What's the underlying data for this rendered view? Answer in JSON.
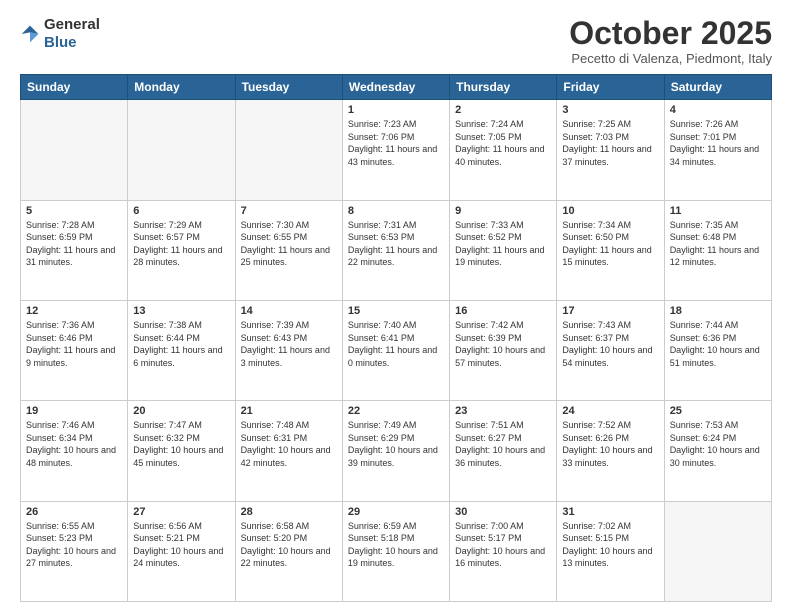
{
  "logo": {
    "general": "General",
    "blue": "Blue"
  },
  "title": "October 2025",
  "location": "Pecetto di Valenza, Piedmont, Italy",
  "days_of_week": [
    "Sunday",
    "Monday",
    "Tuesday",
    "Wednesday",
    "Thursday",
    "Friday",
    "Saturday"
  ],
  "weeks": [
    [
      {
        "day": "",
        "sunrise": "",
        "sunset": "",
        "daylight": ""
      },
      {
        "day": "",
        "sunrise": "",
        "sunset": "",
        "daylight": ""
      },
      {
        "day": "",
        "sunrise": "",
        "sunset": "",
        "daylight": ""
      },
      {
        "day": "1",
        "sunrise": "Sunrise: 7:23 AM",
        "sunset": "Sunset: 7:06 PM",
        "daylight": "Daylight: 11 hours and 43 minutes."
      },
      {
        "day": "2",
        "sunrise": "Sunrise: 7:24 AM",
        "sunset": "Sunset: 7:05 PM",
        "daylight": "Daylight: 11 hours and 40 minutes."
      },
      {
        "day": "3",
        "sunrise": "Sunrise: 7:25 AM",
        "sunset": "Sunset: 7:03 PM",
        "daylight": "Daylight: 11 hours and 37 minutes."
      },
      {
        "day": "4",
        "sunrise": "Sunrise: 7:26 AM",
        "sunset": "Sunset: 7:01 PM",
        "daylight": "Daylight: 11 hours and 34 minutes."
      }
    ],
    [
      {
        "day": "5",
        "sunrise": "Sunrise: 7:28 AM",
        "sunset": "Sunset: 6:59 PM",
        "daylight": "Daylight: 11 hours and 31 minutes."
      },
      {
        "day": "6",
        "sunrise": "Sunrise: 7:29 AM",
        "sunset": "Sunset: 6:57 PM",
        "daylight": "Daylight: 11 hours and 28 minutes."
      },
      {
        "day": "7",
        "sunrise": "Sunrise: 7:30 AM",
        "sunset": "Sunset: 6:55 PM",
        "daylight": "Daylight: 11 hours and 25 minutes."
      },
      {
        "day": "8",
        "sunrise": "Sunrise: 7:31 AM",
        "sunset": "Sunset: 6:53 PM",
        "daylight": "Daylight: 11 hours and 22 minutes."
      },
      {
        "day": "9",
        "sunrise": "Sunrise: 7:33 AM",
        "sunset": "Sunset: 6:52 PM",
        "daylight": "Daylight: 11 hours and 19 minutes."
      },
      {
        "day": "10",
        "sunrise": "Sunrise: 7:34 AM",
        "sunset": "Sunset: 6:50 PM",
        "daylight": "Daylight: 11 hours and 15 minutes."
      },
      {
        "day": "11",
        "sunrise": "Sunrise: 7:35 AM",
        "sunset": "Sunset: 6:48 PM",
        "daylight": "Daylight: 11 hours and 12 minutes."
      }
    ],
    [
      {
        "day": "12",
        "sunrise": "Sunrise: 7:36 AM",
        "sunset": "Sunset: 6:46 PM",
        "daylight": "Daylight: 11 hours and 9 minutes."
      },
      {
        "day": "13",
        "sunrise": "Sunrise: 7:38 AM",
        "sunset": "Sunset: 6:44 PM",
        "daylight": "Daylight: 11 hours and 6 minutes."
      },
      {
        "day": "14",
        "sunrise": "Sunrise: 7:39 AM",
        "sunset": "Sunset: 6:43 PM",
        "daylight": "Daylight: 11 hours and 3 minutes."
      },
      {
        "day": "15",
        "sunrise": "Sunrise: 7:40 AM",
        "sunset": "Sunset: 6:41 PM",
        "daylight": "Daylight: 11 hours and 0 minutes."
      },
      {
        "day": "16",
        "sunrise": "Sunrise: 7:42 AM",
        "sunset": "Sunset: 6:39 PM",
        "daylight": "Daylight: 10 hours and 57 minutes."
      },
      {
        "day": "17",
        "sunrise": "Sunrise: 7:43 AM",
        "sunset": "Sunset: 6:37 PM",
        "daylight": "Daylight: 10 hours and 54 minutes."
      },
      {
        "day": "18",
        "sunrise": "Sunrise: 7:44 AM",
        "sunset": "Sunset: 6:36 PM",
        "daylight": "Daylight: 10 hours and 51 minutes."
      }
    ],
    [
      {
        "day": "19",
        "sunrise": "Sunrise: 7:46 AM",
        "sunset": "Sunset: 6:34 PM",
        "daylight": "Daylight: 10 hours and 48 minutes."
      },
      {
        "day": "20",
        "sunrise": "Sunrise: 7:47 AM",
        "sunset": "Sunset: 6:32 PM",
        "daylight": "Daylight: 10 hours and 45 minutes."
      },
      {
        "day": "21",
        "sunrise": "Sunrise: 7:48 AM",
        "sunset": "Sunset: 6:31 PM",
        "daylight": "Daylight: 10 hours and 42 minutes."
      },
      {
        "day": "22",
        "sunrise": "Sunrise: 7:49 AM",
        "sunset": "Sunset: 6:29 PM",
        "daylight": "Daylight: 10 hours and 39 minutes."
      },
      {
        "day": "23",
        "sunrise": "Sunrise: 7:51 AM",
        "sunset": "Sunset: 6:27 PM",
        "daylight": "Daylight: 10 hours and 36 minutes."
      },
      {
        "day": "24",
        "sunrise": "Sunrise: 7:52 AM",
        "sunset": "Sunset: 6:26 PM",
        "daylight": "Daylight: 10 hours and 33 minutes."
      },
      {
        "day": "25",
        "sunrise": "Sunrise: 7:53 AM",
        "sunset": "Sunset: 6:24 PM",
        "daylight": "Daylight: 10 hours and 30 minutes."
      }
    ],
    [
      {
        "day": "26",
        "sunrise": "Sunrise: 6:55 AM",
        "sunset": "Sunset: 5:23 PM",
        "daylight": "Daylight: 10 hours and 27 minutes."
      },
      {
        "day": "27",
        "sunrise": "Sunrise: 6:56 AM",
        "sunset": "Sunset: 5:21 PM",
        "daylight": "Daylight: 10 hours and 24 minutes."
      },
      {
        "day": "28",
        "sunrise": "Sunrise: 6:58 AM",
        "sunset": "Sunset: 5:20 PM",
        "daylight": "Daylight: 10 hours and 22 minutes."
      },
      {
        "day": "29",
        "sunrise": "Sunrise: 6:59 AM",
        "sunset": "Sunset: 5:18 PM",
        "daylight": "Daylight: 10 hours and 19 minutes."
      },
      {
        "day": "30",
        "sunrise": "Sunrise: 7:00 AM",
        "sunset": "Sunset: 5:17 PM",
        "daylight": "Daylight: 10 hours and 16 minutes."
      },
      {
        "day": "31",
        "sunrise": "Sunrise: 7:02 AM",
        "sunset": "Sunset: 5:15 PM",
        "daylight": "Daylight: 10 hours and 13 minutes."
      },
      {
        "day": "",
        "sunrise": "",
        "sunset": "",
        "daylight": ""
      }
    ]
  ]
}
